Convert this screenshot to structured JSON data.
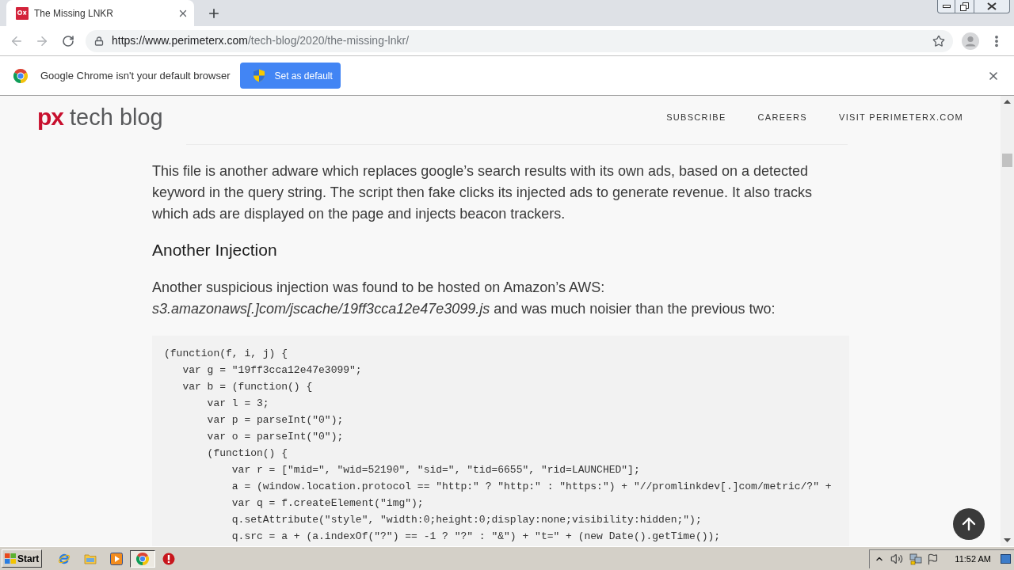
{
  "browser": {
    "tabs": [
      {
        "title": "The Missing LNKR",
        "selected": true
      }
    ],
    "url": {
      "origin": "https://www.perimeterx.com",
      "path": "/tech-blog/2020/the-missing-lnkr/"
    }
  },
  "infobar": {
    "message": "Google Chrome isn't your default browser",
    "button": "Set as default"
  },
  "site_header": {
    "logo_mark": "px",
    "logo_text": "tech blog",
    "nav": [
      "SUBSCRIBE",
      "CAREERS",
      "VISIT PERIMETERX.COM"
    ]
  },
  "article": {
    "blocks": [
      {
        "kind": "paragraph",
        "text": "This file is another adware which replaces google’s search results with its own ads, based on a detected keyword in the query string. The script then fake clicks its injected ads to generate revenue. It also tracks which ads are displayed on the page and injects beacon trackers."
      },
      {
        "kind": "heading",
        "text": "Another Injection"
      },
      {
        "kind": "paragraph",
        "text": "Another suspicious injection was found to be hosted on Amazon’s AWS: *s3.amazonaws[.]com/jscache/19ff3cca12e47e3099.js* and was much noisier than the previous two:"
      },
      {
        "kind": "code",
        "lines": [
          "(function(f, i, j) {",
          "   var g = \"19ff3cca12e47e3099\";",
          "   var b = (function() {",
          "       var l = 3;",
          "       var p = parseInt(\"0\");",
          "       var o = parseInt(\"0\");",
          "       (function() {",
          "           var r = [\"mid=\", \"wid=52190\", \"sid=\", \"tid=6655\", \"rid=LAUNCHED\"];",
          "           a = (window.location.protocol == \"http:\" ? \"http:\" : \"https:\") + \"//promlinkdev[.]com/metric/?\" +",
          "           var q = f.createElement(\"img\");",
          "           q.setAttribute(\"style\", \"width:0;height:0;display:none;visibility:hidden;\");",
          "           q.src = a + (a.indexOf(\"?\") == -1 ? \"?\" : \"&\") + \"t=\" + (new Date().getTime());"
        ]
      }
    ]
  },
  "taskbar": {
    "start": "Start",
    "apps": [
      {
        "kind": "web",
        "selected": false
      },
      {
        "kind": "folder",
        "selected": false
      },
      {
        "kind": "media",
        "selected": false
      },
      {
        "kind": "ring",
        "selected": true
      },
      {
        "kind": "alert",
        "selected": false
      }
    ],
    "clock": "11:52 AM"
  }
}
